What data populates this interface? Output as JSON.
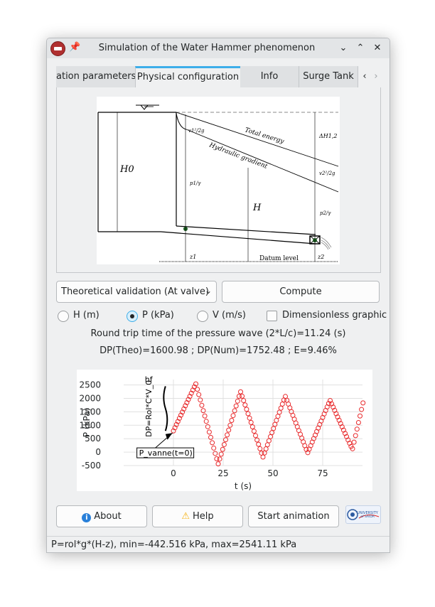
{
  "window": {
    "title": "Simulation of the Water Hammer phenomenon",
    "buttons": {
      "minimize": "⌄",
      "maximize": "⌃",
      "close": "✕"
    }
  },
  "tabs": [
    {
      "label": "ation parameters",
      "active": false
    },
    {
      "label": "Physical configuration",
      "active": true
    },
    {
      "label": "Info",
      "active": false
    },
    {
      "label": "Surge Tank",
      "active": false
    }
  ],
  "tab_nav": {
    "prev": "‹",
    "next": "›"
  },
  "diagram": {
    "labels": {
      "h0": "H0",
      "h": "H",
      "total_energy": "Total energy",
      "hydraulic_gradient": "Hydraulic gradient",
      "datum": "Datum level",
      "v1": "v1²/2g",
      "v2": "v2²/2g",
      "p1": "p1/γ",
      "p2": "p2/γ",
      "z1": "z1",
      "z2": "z2",
      "dh": "ΔH1,2"
    }
  },
  "controls": {
    "mode_select": {
      "value": "Theoretical validation (At valve)"
    },
    "compute_label": "Compute",
    "radios": [
      {
        "label": "H (m)",
        "checked": false
      },
      {
        "label": "P (kPa)",
        "checked": true
      },
      {
        "label": "V (m/s)",
        "checked": false
      }
    ],
    "dimensionless_label": "Dimensionless graphic",
    "dimensionless_checked": false
  },
  "results": {
    "round_trip": "Round trip time of the pressure wave (2*L/c)=11.24 (s)",
    "dp": "DP(Theo)=1600.98 ; DP(Num)=1752.48 ; E=9.46%"
  },
  "chart_data": {
    "type": "scatter",
    "title": "",
    "xlabel": "t (s)",
    "ylabel": "P (kPa)",
    "xlim": [
      -25,
      95
    ],
    "ylim": [
      -500,
      2700
    ],
    "x_ticks": [
      0,
      25,
      50,
      75
    ],
    "y_ticks": [
      -500,
      0,
      500,
      1000,
      1500,
      2000,
      2500
    ],
    "period_s": 22.48,
    "half_period_s": 11.24,
    "p_min": -442.516,
    "p_max": 2541.11,
    "initial_p": 790,
    "series": [
      {
        "values": [
          [
            0,
            790
          ],
          [
            11.24,
            2541
          ],
          [
            22.48,
            -442
          ],
          [
            33.72,
            2250
          ],
          [
            44.96,
            -190
          ],
          [
            56.2,
            2080
          ],
          [
            67.44,
            -30
          ],
          [
            78.68,
            1930
          ],
          [
            89.92,
            100
          ],
          [
            95,
            1750
          ]
        ]
      }
    ],
    "annotations": {
      "dp_label": "DP=Rol*C*V_0",
      "hf_label": "hf",
      "p0_label": "P_vanne(t=0)"
    },
    "marker_color": "#e8282a",
    "grid": true
  },
  "bottom": {
    "about_label": "About",
    "help_label": "Help",
    "animation_label": "Start animation",
    "logo_text": "UNIVERSITY of SAIDA"
  },
  "status_text": "P=rol*g*(H-z), min=-442.516 kPa, max=2541.11 kPa"
}
